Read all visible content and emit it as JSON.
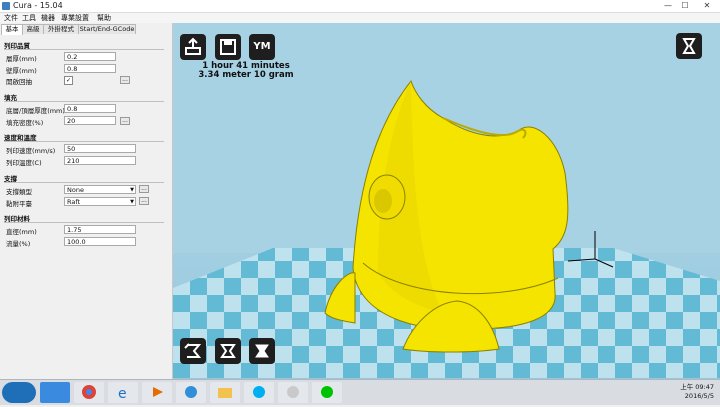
{
  "window": {
    "title": "Cura - 15.04",
    "minimize": "—",
    "maximize": "☐",
    "close": "✕"
  },
  "menu": [
    "文件",
    "工具",
    "機器",
    "專業設置",
    "幫助"
  ],
  "tabs": [
    "基本",
    "高級",
    "外掛程式",
    "Start/End-GCode"
  ],
  "sections": {
    "quality": {
      "title": "列印品質",
      "rows": [
        {
          "label": "層厚(mm)",
          "value": "0.2"
        },
        {
          "label": "壁厚(mm)",
          "value": "0.8"
        },
        {
          "label": "開啟回抽",
          "value": "✓",
          "more": "..."
        }
      ]
    },
    "fill": {
      "title": "填充",
      "rows": [
        {
          "label": "底層/頂層厚度(mm)",
          "value": "0.8"
        },
        {
          "label": "填充密度(%)",
          "value": "20",
          "more": "..."
        }
      ]
    },
    "speed": {
      "title": "速度和溫度",
      "rows": [
        {
          "label": "列印速度(mm/s)",
          "value": "50"
        },
        {
          "label": "列印溫度(C)",
          "value": "210"
        }
      ]
    },
    "support": {
      "title": "支撐",
      "rows": [
        {
          "label": "支撐類型",
          "value": "None",
          "more": "..."
        },
        {
          "label": "黏附平臺",
          "value": "Raft",
          "more": "..."
        }
      ]
    },
    "filament": {
      "title": "列印材料",
      "rows": [
        {
          "label": "直徑(mm)",
          "value": "1.75"
        },
        {
          "label": "流量(%)",
          "value": "100.0"
        }
      ]
    }
  },
  "viewport": {
    "toolbar": [
      "load-icon",
      "save-icon",
      "YM"
    ],
    "info_line1": "1 hour 41 minutes",
    "info_line2": "3.34 meter 10 gram",
    "view_mode_icon": "view-mode-icon",
    "model_color": "#f5e400",
    "bottom_tools": [
      "rotate-icon",
      "scale-icon",
      "mirror-icon"
    ]
  },
  "taskbar": {
    "apps": [
      "start-icon",
      "chrome-icon",
      "ie-icon",
      "media-icon",
      "network-icon",
      "explorer-icon",
      "skype-icon",
      "paint-icon",
      "line-icon"
    ],
    "time": "上午 09:47",
    "date": "2016/5/5"
  }
}
